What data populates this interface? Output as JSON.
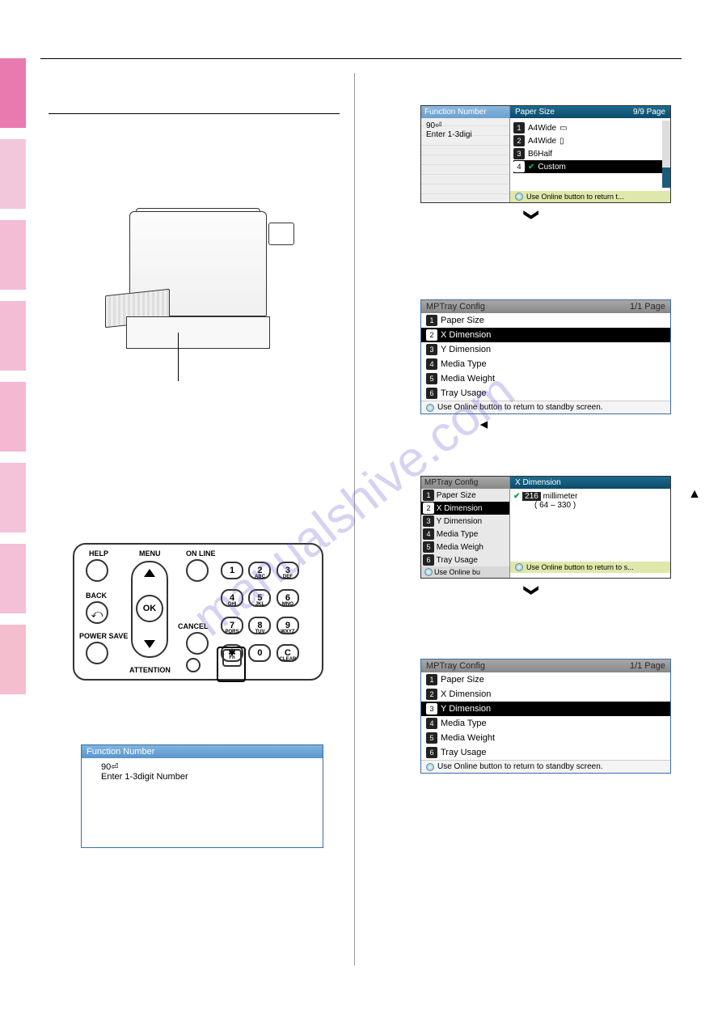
{
  "sidebar": {},
  "left": {
    "fn_screen": {
      "title": "Function Number",
      "value": "90",
      "hint": "Enter 1-3digit Number"
    },
    "keypad": {
      "help": "HELP",
      "back": "BACK",
      "menu": "MENU",
      "ok": "OK",
      "cancel": "CANCEL",
      "online": "ON LINE",
      "powersave": "POWER SAVE",
      "attention": "ATTENTION",
      "keys": {
        "k1": "1",
        "k2": "2",
        "k2s": "ABC",
        "k3": "3",
        "k3s": "DEF",
        "k4": "4",
        "k4s": "GHI",
        "k5": "5",
        "k5s": "JKL",
        "k6": "6",
        "k6s": "MNO",
        "k7": "7",
        "k7s": "PQRS",
        "k8": "8",
        "k8s": "TUV",
        "k9": "9",
        "k9s": "WXYZ",
        "kstar": "✱",
        "kfn": "Fn",
        "k0": "0",
        "kc": "C",
        "kcs": "CLEAR"
      }
    }
  },
  "right": {
    "ss1": {
      "left_title": "Function Number",
      "left_val": "90",
      "left_hint": "Enter 1-3digi",
      "right_title": "Paper Size",
      "right_page": "9/9 Page",
      "items": [
        {
          "n": "1",
          "label": "A4Wide"
        },
        {
          "n": "2",
          "label": "A4Wide"
        },
        {
          "n": "3",
          "label": "B6Half"
        },
        {
          "n": "4",
          "label": "Custom",
          "sel": true,
          "check": true
        }
      ],
      "footer": "Use Online button to return t..."
    },
    "ss2": {
      "title": "MPTray Config",
      "page": "1/1 Page",
      "items": [
        {
          "n": "1",
          "label": "Paper Size"
        },
        {
          "n": "2",
          "label": "X Dimension",
          "sel": true
        },
        {
          "n": "3",
          "label": "Y Dimension"
        },
        {
          "n": "4",
          "label": "Media Type"
        },
        {
          "n": "5",
          "label": "Media Weight"
        },
        {
          "n": "6",
          "label": "Tray Usage"
        }
      ],
      "footer": "Use Online button to return to standby screen."
    },
    "ss3": {
      "left_title": "MPTray Config",
      "right_title": "X Dimension",
      "left_items": [
        {
          "n": "1",
          "label": "Paper Size"
        },
        {
          "n": "2",
          "label": "X Dimension",
          "sel": true
        },
        {
          "n": "3",
          "label": "Y Dimension"
        },
        {
          "n": "4",
          "label": "Media Type"
        },
        {
          "n": "5",
          "label": "Media Weigh"
        },
        {
          "n": "6",
          "label": "Tray Usage"
        }
      ],
      "value": "216",
      "unit": "millimeter",
      "range": "( 64 – 330 )",
      "left_footer": "Use Online bu",
      "footer": "Use Online button to return to s..."
    },
    "ss4": {
      "title": "MPTray Config",
      "page": "1/1 Page",
      "items": [
        {
          "n": "1",
          "label": "Paper Size"
        },
        {
          "n": "2",
          "label": "X Dimension"
        },
        {
          "n": "3",
          "label": "Y Dimension",
          "sel": true
        },
        {
          "n": "4",
          "label": "Media Type"
        },
        {
          "n": "5",
          "label": "Media Weight"
        },
        {
          "n": "6",
          "label": "Tray Usage"
        }
      ],
      "footer": "Use Online button to return to standby screen."
    }
  },
  "watermark": "manualshive.com",
  "chart_data": null
}
